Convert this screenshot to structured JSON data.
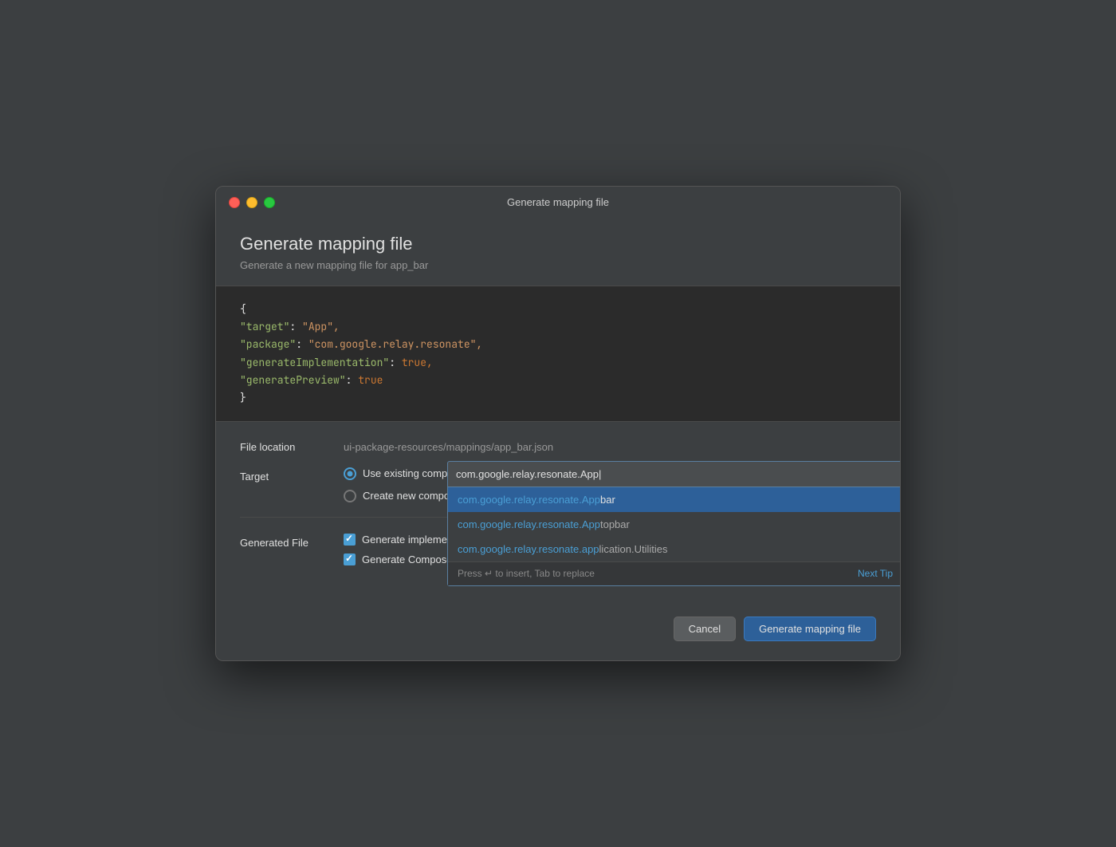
{
  "titlebar": {
    "title": "Generate mapping file"
  },
  "header": {
    "title": "Generate mapping file",
    "subtitle": "Generate a new mapping file for app_bar"
  },
  "code": {
    "brace_open": "{",
    "line1_key": "\"target\"",
    "line1_value": "\"App\",",
    "line2_key": "\"package\"",
    "line2_value": "\"com.google.relay.resonate\",",
    "line3_key": "\"generateImplementation\"",
    "line3_value_bool": "true,",
    "line4_key": "\"generatePreview\"",
    "line4_value_bool": "true",
    "brace_close": "}"
  },
  "form": {
    "file_location_label": "File location",
    "file_location_value": "ui-package-resources/mappings/app_bar.json",
    "target_label": "Target",
    "radio_existing_label": "Use existing composable",
    "radio_new_label": "Create new composable",
    "generated_file_label": "Generated File",
    "checkbox_impl_label": "Generate implementation",
    "checkbox_preview_label": "Generate Compose preview"
  },
  "autocomplete": {
    "input_value": "com.google.relay.resonate.App|",
    "items": [
      {
        "prefix": "com.google.relay.resonate.App",
        "suffix": "bar",
        "selected": true
      },
      {
        "prefix": "com.google.relay.resonate.App",
        "suffix": "topbar",
        "selected": false
      },
      {
        "prefix": "com.google.relay.resonate.app",
        "suffix": "lication.Utilities",
        "selected": false
      }
    ],
    "hint": "Press ↵ to insert, Tab to replace",
    "next_tip_label": "Next Tip",
    "more_icon": "⋮"
  },
  "buttons": {
    "cancel_label": "Cancel",
    "primary_label": "Generate mapping file"
  }
}
